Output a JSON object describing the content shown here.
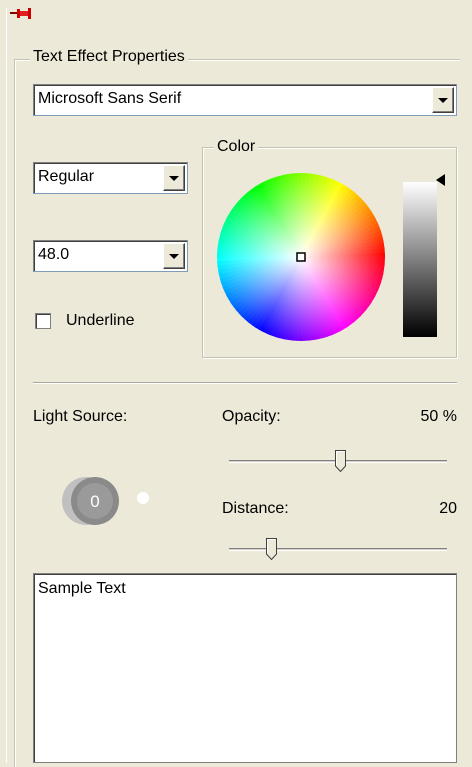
{
  "panel": {
    "group_title": "Text Effect Properties",
    "pin_icon": "pushpin-icon"
  },
  "font": {
    "family": "Microsoft Sans Serif",
    "style": "Regular",
    "size": "48.0"
  },
  "underline": {
    "label": "Underline",
    "checked": false
  },
  "color": {
    "title": "Color",
    "selected": "#ffffff",
    "brightness": 1.0
  },
  "light_source": {
    "label": "Light Source:",
    "value": "0"
  },
  "opacity": {
    "label": "Opacity:",
    "value_text": "50 %",
    "value": 50
  },
  "distance": {
    "label": "Distance:",
    "value_text": "20",
    "value": 20
  },
  "sample": {
    "text": "Sample Text"
  },
  "colors": {
    "background": "#ece9d8",
    "pin": "#cc0000"
  }
}
